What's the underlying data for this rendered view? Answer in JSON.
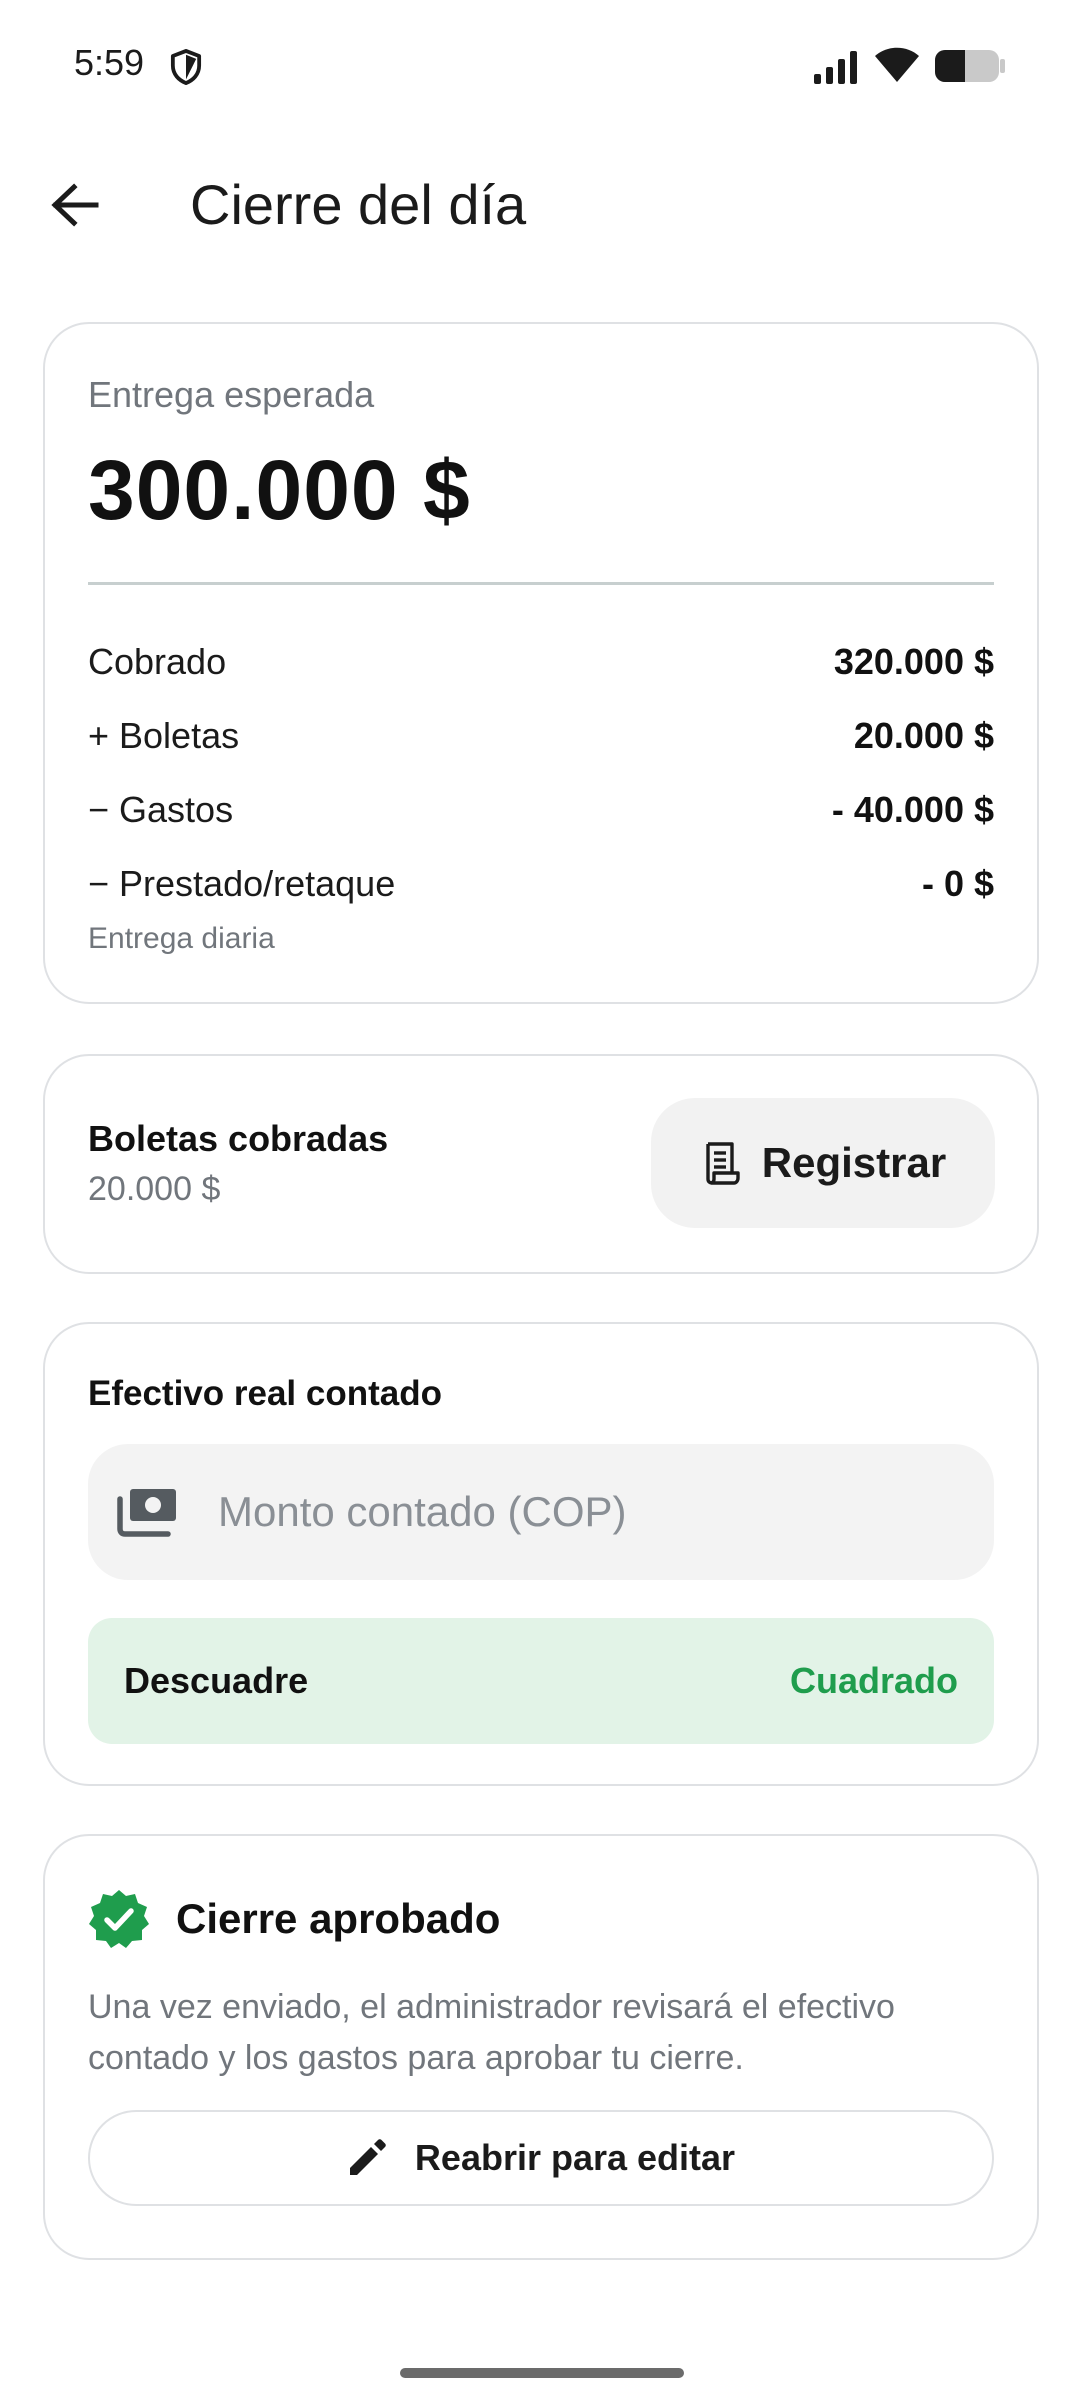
{
  "status_bar": {
    "time": "5:59",
    "icons": [
      "shield-icon",
      "signal-icon",
      "wifi-icon",
      "battery-icon"
    ]
  },
  "app_bar": {
    "title": "Cierre del día",
    "back_icon": "arrow-left-icon"
  },
  "summary": {
    "expected_label": "Entrega esperada",
    "expected_amount": "300.000 $",
    "rows": [
      {
        "label": "Cobrado",
        "value": "320.000 $"
      },
      {
        "label": "+ Boletas",
        "value": "20.000 $"
      },
      {
        "label": "− Gastos",
        "value": "- 40.000 $"
      },
      {
        "label": "− Prestado/retaque",
        "value": "- 0 $"
      }
    ],
    "note": "Entrega diaria"
  },
  "boletas": {
    "title": "Boletas cobradas",
    "amount": "20.000 $",
    "button_label": "Registrar",
    "button_icon": "receipt-icon"
  },
  "cash": {
    "title": "Efectivo real contado",
    "input_placeholder": "Monto contado (COP)",
    "input_value": "",
    "input_icon": "cash-icon",
    "mismatch_label": "Descuadre",
    "mismatch_status": "Cuadrado"
  },
  "approval": {
    "title": "Cierre aprobado",
    "icon": "verified-badge-icon",
    "description": "Una vez enviado, el administrador revisará el efectivo contado y los gastos para aprobar tu cierre.",
    "reopen_label": "Reabrir para editar",
    "reopen_icon": "pencil-icon"
  },
  "colors": {
    "accent_green": "#1f9d4d",
    "success_bg": "#e2f3e7",
    "muted_text": "#71767c",
    "card_border": "#dfe1e4"
  }
}
